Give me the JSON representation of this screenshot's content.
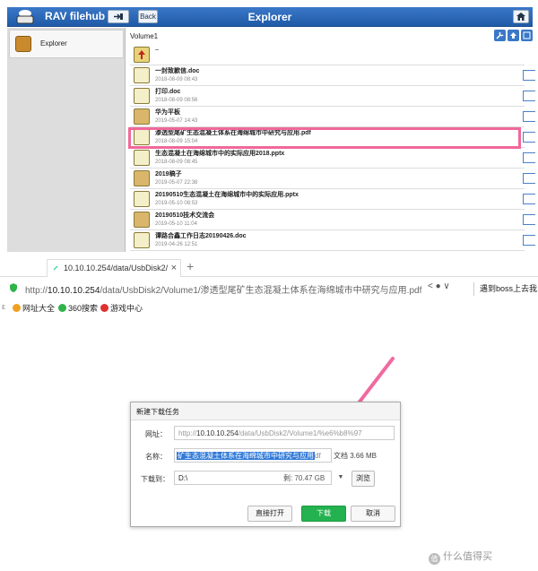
{
  "app": {
    "title": "RAV filehub",
    "back_label": "Back",
    "view_title": "Explorer"
  },
  "sidebar": {
    "items": [
      {
        "label": "Explorer"
      }
    ]
  },
  "breadcrumb": "Volume1",
  "files": [
    {
      "name": "..",
      "date": "",
      "type": "up"
    },
    {
      "name": "一封致歉信.doc",
      "date": "2018-08-09 08:43",
      "type": "doc"
    },
    {
      "name": "打印.doc",
      "date": "2018-08-09 08:56",
      "type": "doc"
    },
    {
      "name": "华为平板",
      "date": "2019-05-07 14:43",
      "type": "folder"
    },
    {
      "name": "渗透型尾矿生态混凝土体系在海绵城市中研究与应用.pdf",
      "date": "2018-08-09 15:04",
      "type": "doc"
    },
    {
      "name": "生态混凝土在海绵城市中的实际应用2018.pptx",
      "date": "2018-08-09 08:45",
      "type": "doc"
    },
    {
      "name": "2019稿子",
      "date": "2019-05-07 22:38",
      "type": "folder"
    },
    {
      "name": "20190510生态混凝土在海绵城市中的实际应用.pptx",
      "date": "2019-05-10 08:53",
      "type": "doc"
    },
    {
      "name": "20190510技术交流会",
      "date": "2019-05-10 11:04",
      "type": "folder"
    },
    {
      "name": "谭路合鑫工作日志20190426.doc",
      "date": "2019-04-26 12:51",
      "type": "doc"
    }
  ],
  "browser": {
    "tab_title": "10.10.10.254/data/UsbDisk2/",
    "url_prefix": "http://",
    "url_host": "10.10.10.254",
    "url_path": "/data/UsbDisk2/Volume1/渗透型尾矿生态混凝土体系在海绵城市中研究与应用.pdf",
    "search_text": "遇到boss上去我",
    "favorites": [
      {
        "label": "网址大全",
        "color": "#f0a020"
      },
      {
        "label": "360搜索",
        "color": "#2fb34a"
      },
      {
        "label": "游戏中心",
        "color": "#e03030"
      }
    ]
  },
  "dialog": {
    "title": "新建下载任务",
    "url_label": "网址：",
    "url_prefix": "http://",
    "url_host": "10.10.10.254",
    "url_rest": "/data/UsbDisk2/Volume1/%e6%b8%97",
    "name_label": "名称：",
    "name_selected": "矿生态混凝土体系在海绵城市中研究与应用",
    "name_rest": "df",
    "file_info": "文档 3.66 MB",
    "save_label": "下载到：",
    "save_path": "D:\\",
    "free_space": "剩: 70.47 GB",
    "browse": "浏览",
    "open_direct": "直接打开",
    "download": "下载",
    "cancel": "取消"
  },
  "watermark": "什么值得买",
  "colors": {
    "header": "#2f6bb8",
    "highlight": "#f0689a",
    "download": "#23b24f"
  }
}
